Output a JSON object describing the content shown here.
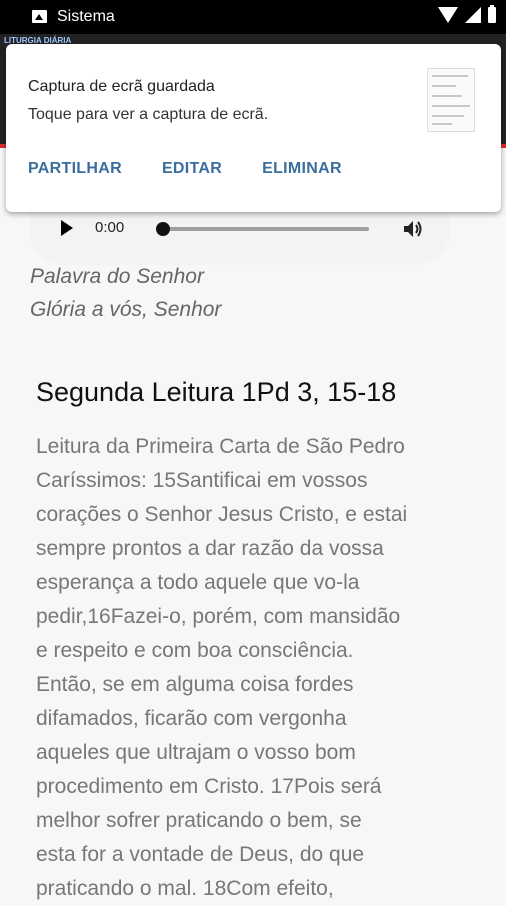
{
  "status_bar": {
    "app_name": "Sistema"
  },
  "app_bar": {
    "tag": "LITURGIA DIÁRIA"
  },
  "notification": {
    "title": "Captura de ecrã guardada",
    "text": "Toque para ver a captura de ecrã.",
    "actions": [
      "PARTILHAR",
      "EDITAR",
      "ELIMINAR"
    ]
  },
  "audio_player": {
    "time": "0:00"
  },
  "reading_end": {
    "palavra": "Palavra do Senhor",
    "response": "Glória a vós, Senhor"
  },
  "second_reading": {
    "heading": "Segunda Leitura 1Pd 3, 15-18",
    "text": "Leitura da Primeira Carta de São Pedro\nCaríssimos: 15Santificai em vossos\ncorações o Senhor Jesus Cristo, e estai\nsempre prontos a dar razão da vossa\nesperança a todo aquele que vo-la\npedir,16Fazei-o, porém, com mansidão\ne respeito e com boa consciência.\nEntão, se em alguma coisa fordes\ndifamados, ficarão com vergonha\naqueles que ultrajam o vosso bom\nprocedimento em Cristo. 17Pois será\nmelhor sofrer praticando o bem, se\nesta for a vontade de Deus, do que\npraticando o mal. 18Com efeito,"
  }
}
